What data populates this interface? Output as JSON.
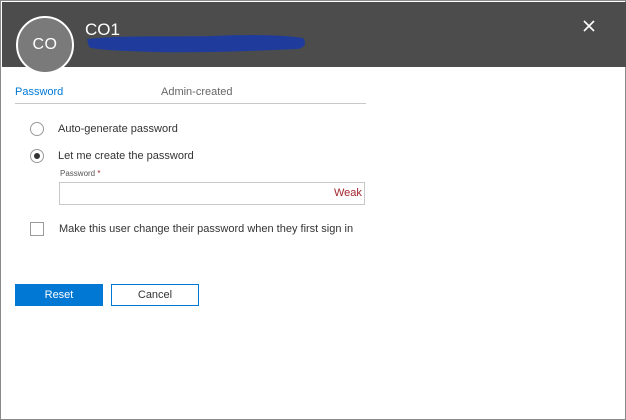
{
  "header": {
    "avatar_initials": "CO",
    "display_name": "CO1",
    "close_icon": "close-icon",
    "background_color": "#4c4c4c"
  },
  "tabs": [
    {
      "label": "Password",
      "active": true
    },
    {
      "label": "Admin-created",
      "active": false
    }
  ],
  "password_options": [
    {
      "label": "Auto-generate password",
      "selected": false
    },
    {
      "label": "Let me create the password",
      "selected": true
    }
  ],
  "password_field": {
    "label": "Password",
    "required_mark": "*",
    "value": "",
    "strength": "Weak"
  },
  "force_change": {
    "label": "Make this user change their password when they first sign in",
    "checked": false
  },
  "buttons": {
    "reset_label": "Reset",
    "cancel_label": "Cancel"
  },
  "colors": {
    "accent": "#0078d4",
    "weak": "#a4262c"
  }
}
